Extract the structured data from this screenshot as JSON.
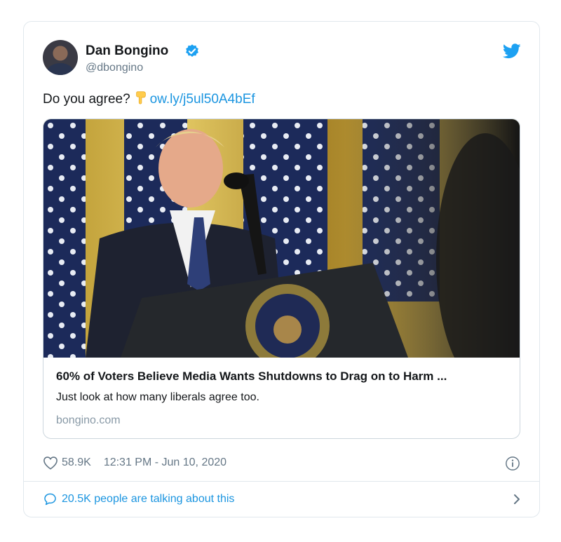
{
  "author": {
    "name": "Dan Bongino",
    "handle": "@dbongino"
  },
  "tweet": {
    "text": "Do you agree?",
    "emoji": "backhand-index-pointing-down",
    "link_text": "ow.ly/j5ul50A4bEf"
  },
  "link_card": {
    "image_alt": "Photo of a speaker at a presidential podium in front of flags",
    "title": "60% of Voters Believe Media Wants Shutdowns to Drag on to Harm ...",
    "description": "Just look at how many liberals agree too.",
    "domain": "bongino.com"
  },
  "meta": {
    "likes": "58.9K",
    "timestamp": "12:31 PM - Jun 10, 2020"
  },
  "conversation": {
    "label": "20.5K people are talking about this"
  },
  "colors": {
    "accent": "#1b95e0",
    "text": "#14171a",
    "secondary": "#657786",
    "border": "#e1e8ed"
  },
  "icons": [
    "verified-icon",
    "twitter-logo-icon",
    "heart-icon",
    "info-icon",
    "reply-icon",
    "chevron-right-icon"
  ]
}
